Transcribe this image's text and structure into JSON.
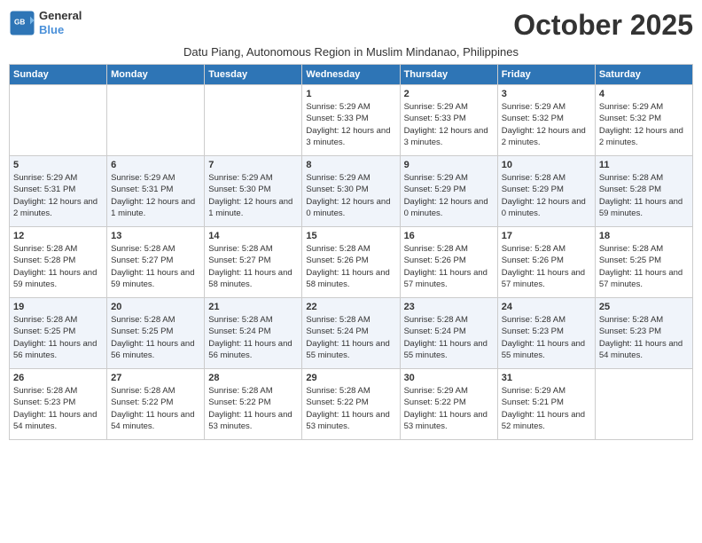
{
  "logo": {
    "line1": "General",
    "line2": "Blue"
  },
  "title": "October 2025",
  "subtitle": "Datu Piang, Autonomous Region in Muslim Mindanao, Philippines",
  "weekdays": [
    "Sunday",
    "Monday",
    "Tuesday",
    "Wednesday",
    "Thursday",
    "Friday",
    "Saturday"
  ],
  "weeks": [
    [
      {
        "day": "",
        "info": ""
      },
      {
        "day": "",
        "info": ""
      },
      {
        "day": "",
        "info": ""
      },
      {
        "day": "1",
        "info": "Sunrise: 5:29 AM\nSunset: 5:33 PM\nDaylight: 12 hours and 3 minutes."
      },
      {
        "day": "2",
        "info": "Sunrise: 5:29 AM\nSunset: 5:33 PM\nDaylight: 12 hours and 3 minutes."
      },
      {
        "day": "3",
        "info": "Sunrise: 5:29 AM\nSunset: 5:32 PM\nDaylight: 12 hours and 2 minutes."
      },
      {
        "day": "4",
        "info": "Sunrise: 5:29 AM\nSunset: 5:32 PM\nDaylight: 12 hours and 2 minutes."
      }
    ],
    [
      {
        "day": "5",
        "info": "Sunrise: 5:29 AM\nSunset: 5:31 PM\nDaylight: 12 hours and 2 minutes."
      },
      {
        "day": "6",
        "info": "Sunrise: 5:29 AM\nSunset: 5:31 PM\nDaylight: 12 hours and 1 minute."
      },
      {
        "day": "7",
        "info": "Sunrise: 5:29 AM\nSunset: 5:30 PM\nDaylight: 12 hours and 1 minute."
      },
      {
        "day": "8",
        "info": "Sunrise: 5:29 AM\nSunset: 5:30 PM\nDaylight: 12 hours and 0 minutes."
      },
      {
        "day": "9",
        "info": "Sunrise: 5:29 AM\nSunset: 5:29 PM\nDaylight: 12 hours and 0 minutes."
      },
      {
        "day": "10",
        "info": "Sunrise: 5:28 AM\nSunset: 5:29 PM\nDaylight: 12 hours and 0 minutes."
      },
      {
        "day": "11",
        "info": "Sunrise: 5:28 AM\nSunset: 5:28 PM\nDaylight: 11 hours and 59 minutes."
      }
    ],
    [
      {
        "day": "12",
        "info": "Sunrise: 5:28 AM\nSunset: 5:28 PM\nDaylight: 11 hours and 59 minutes."
      },
      {
        "day": "13",
        "info": "Sunrise: 5:28 AM\nSunset: 5:27 PM\nDaylight: 11 hours and 59 minutes."
      },
      {
        "day": "14",
        "info": "Sunrise: 5:28 AM\nSunset: 5:27 PM\nDaylight: 11 hours and 58 minutes."
      },
      {
        "day": "15",
        "info": "Sunrise: 5:28 AM\nSunset: 5:26 PM\nDaylight: 11 hours and 58 minutes."
      },
      {
        "day": "16",
        "info": "Sunrise: 5:28 AM\nSunset: 5:26 PM\nDaylight: 11 hours and 57 minutes."
      },
      {
        "day": "17",
        "info": "Sunrise: 5:28 AM\nSunset: 5:26 PM\nDaylight: 11 hours and 57 minutes."
      },
      {
        "day": "18",
        "info": "Sunrise: 5:28 AM\nSunset: 5:25 PM\nDaylight: 11 hours and 57 minutes."
      }
    ],
    [
      {
        "day": "19",
        "info": "Sunrise: 5:28 AM\nSunset: 5:25 PM\nDaylight: 11 hours and 56 minutes."
      },
      {
        "day": "20",
        "info": "Sunrise: 5:28 AM\nSunset: 5:25 PM\nDaylight: 11 hours and 56 minutes."
      },
      {
        "day": "21",
        "info": "Sunrise: 5:28 AM\nSunset: 5:24 PM\nDaylight: 11 hours and 56 minutes."
      },
      {
        "day": "22",
        "info": "Sunrise: 5:28 AM\nSunset: 5:24 PM\nDaylight: 11 hours and 55 minutes."
      },
      {
        "day": "23",
        "info": "Sunrise: 5:28 AM\nSunset: 5:24 PM\nDaylight: 11 hours and 55 minutes."
      },
      {
        "day": "24",
        "info": "Sunrise: 5:28 AM\nSunset: 5:23 PM\nDaylight: 11 hours and 55 minutes."
      },
      {
        "day": "25",
        "info": "Sunrise: 5:28 AM\nSunset: 5:23 PM\nDaylight: 11 hours and 54 minutes."
      }
    ],
    [
      {
        "day": "26",
        "info": "Sunrise: 5:28 AM\nSunset: 5:23 PM\nDaylight: 11 hours and 54 minutes."
      },
      {
        "day": "27",
        "info": "Sunrise: 5:28 AM\nSunset: 5:22 PM\nDaylight: 11 hours and 54 minutes."
      },
      {
        "day": "28",
        "info": "Sunrise: 5:28 AM\nSunset: 5:22 PM\nDaylight: 11 hours and 53 minutes."
      },
      {
        "day": "29",
        "info": "Sunrise: 5:28 AM\nSunset: 5:22 PM\nDaylight: 11 hours and 53 minutes."
      },
      {
        "day": "30",
        "info": "Sunrise: 5:29 AM\nSunset: 5:22 PM\nDaylight: 11 hours and 53 minutes."
      },
      {
        "day": "31",
        "info": "Sunrise: 5:29 AM\nSunset: 5:21 PM\nDaylight: 11 hours and 52 minutes."
      },
      {
        "day": "",
        "info": ""
      }
    ]
  ]
}
